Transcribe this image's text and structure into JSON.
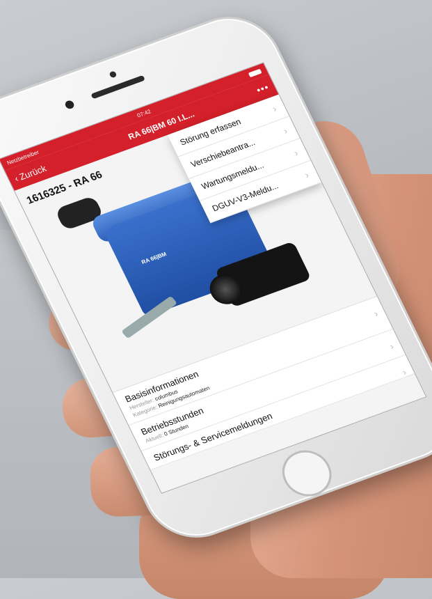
{
  "status_bar": {
    "carrier": "Netzbetreiber",
    "time": "07:42"
  },
  "navbar": {
    "back_label": "Zurück",
    "title": "RA 66|BM 60 I.L...",
    "more_label": "•••"
  },
  "page": {
    "heading": "1616325 - RA 66"
  },
  "product": {
    "brand_text": "RA 66|BM"
  },
  "menu": {
    "items": [
      {
        "label": "Störung erfassen"
      },
      {
        "label": "Verschiebeantra..."
      },
      {
        "label": "Wartungsmeldu..."
      },
      {
        "label": "DGUV-V3-Meldu..."
      }
    ]
  },
  "details": {
    "base": {
      "title": "Basisinformationen",
      "manufacturer_label": "Hersteller:",
      "manufacturer_value": "columbus",
      "category_label": "Kategorie:",
      "category_value": "Reinigungsautomaten"
    },
    "hours": {
      "title": "Betriebsstunden",
      "current_label": "Aktuell:",
      "current_value": "0 Stunden"
    },
    "reports": {
      "title": "Störungs- & Servicemeldungen"
    }
  },
  "colors": {
    "accent": "#d3202a"
  }
}
